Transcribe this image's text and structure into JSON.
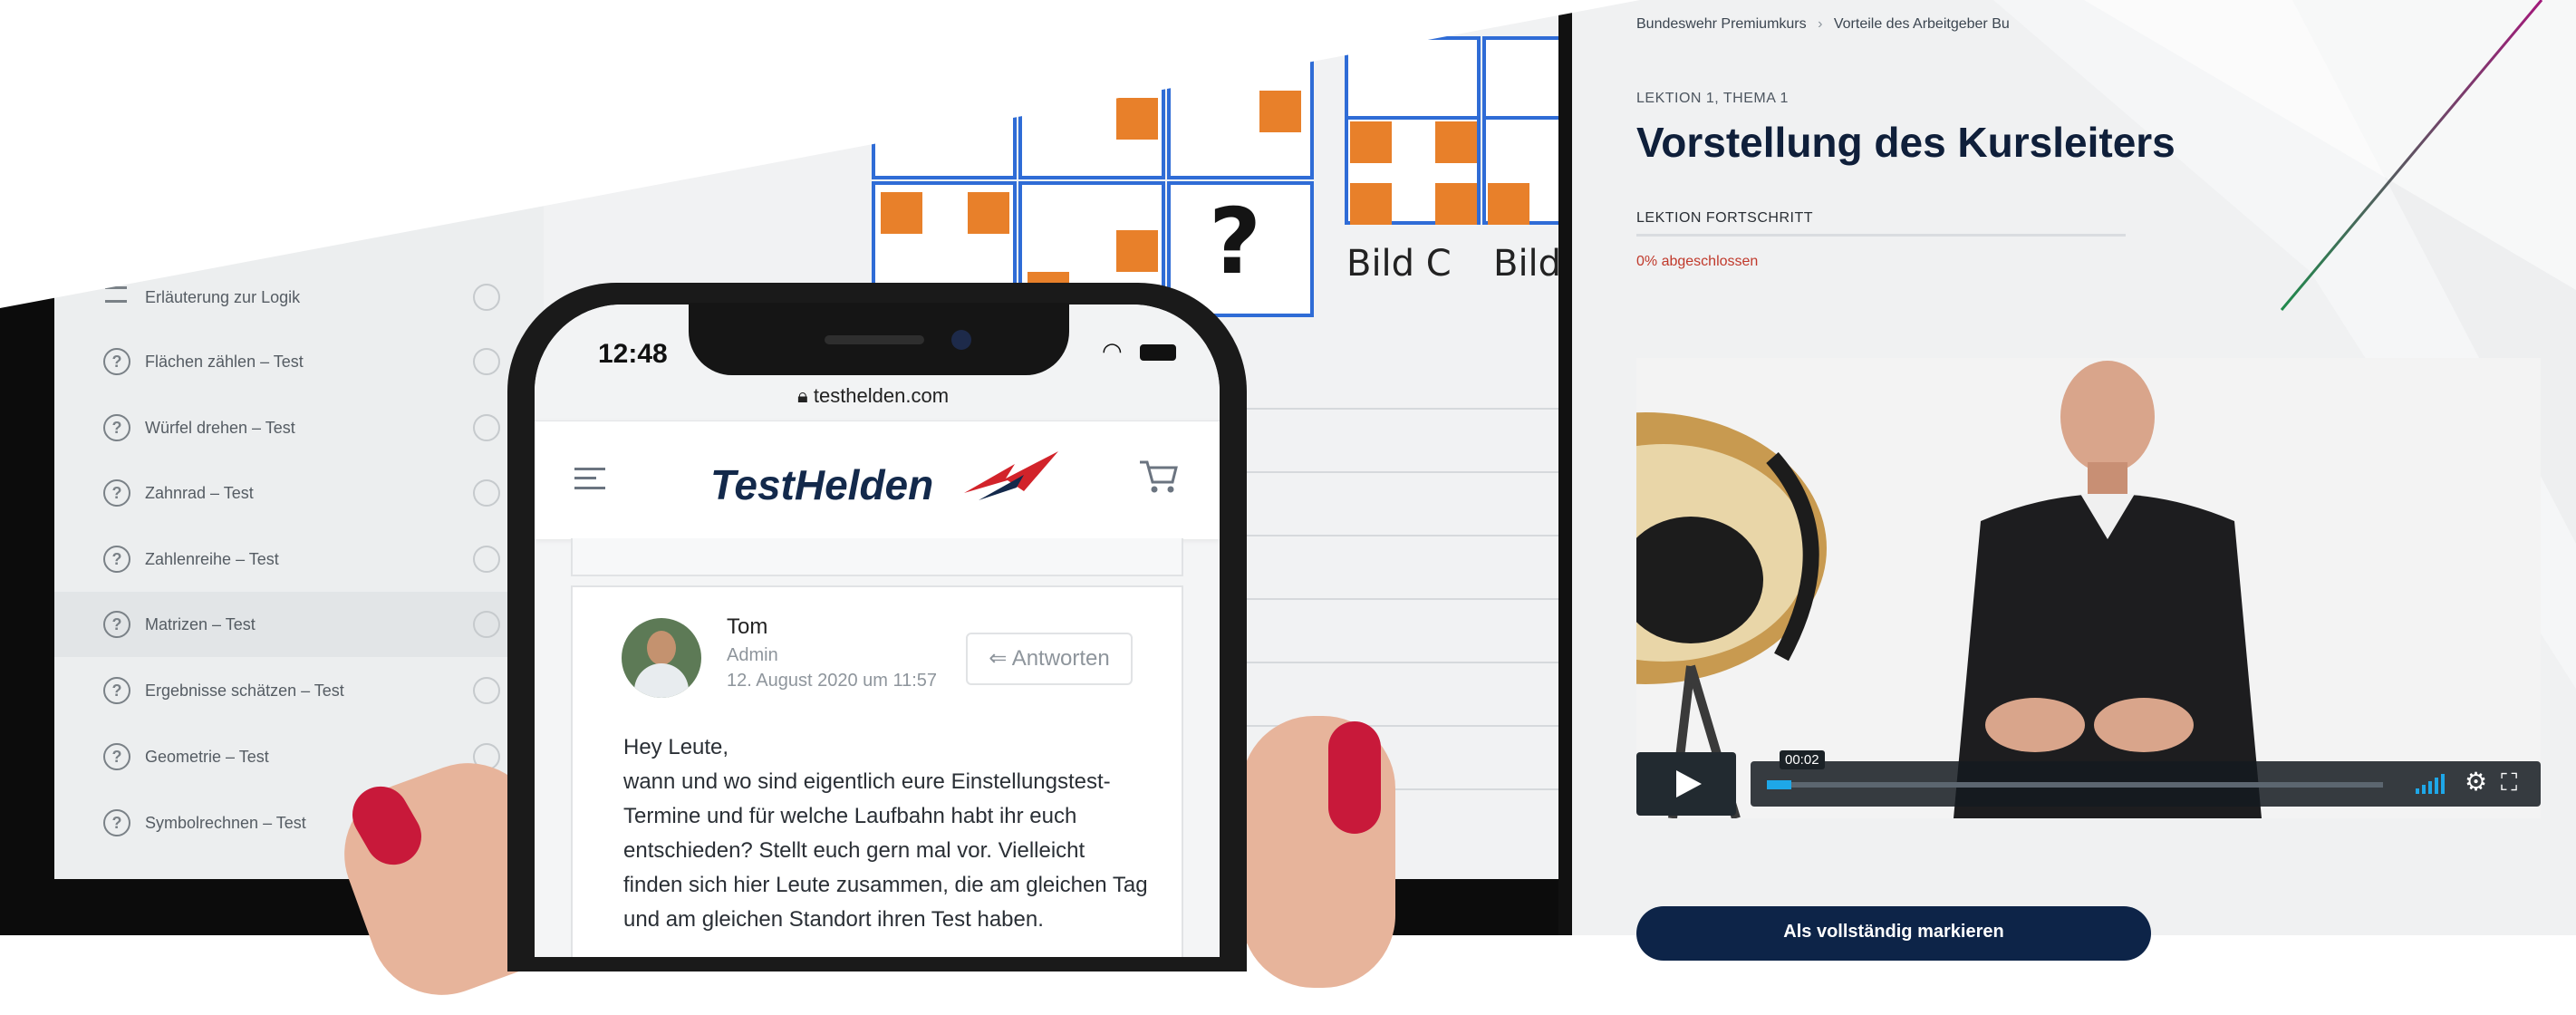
{
  "tablet": {
    "sidebar_items": [
      {
        "label": "Erläuterung zur Logik",
        "icon": "list-icon"
      },
      {
        "label": "Flächen zählen – Test",
        "icon": "question-icon"
      },
      {
        "label": "Würfel drehen – Test",
        "icon": "question-icon"
      },
      {
        "label": "Zahnrad – Test",
        "icon": "question-icon"
      },
      {
        "label": "Zahlenreihe – Test",
        "icon": "question-icon"
      },
      {
        "label": "Matrizen – Test",
        "icon": "question-icon"
      },
      {
        "label": "Ergebnisse schätzen – Test",
        "icon": "question-icon"
      },
      {
        "label": "Geometrie – Test",
        "icon": "question-icon"
      },
      {
        "label": "Symbolrechnen – Test",
        "icon": "question-icon"
      }
    ],
    "puzzle": {
      "question_mark": "?",
      "option_c": "Bild C",
      "option_d": "Bild D",
      "accent_orange": "#e8802a",
      "grid_blue": "#2f6cd6"
    }
  },
  "phone": {
    "time": "12:48",
    "url": "testhelden.com",
    "brand": "TestHelden",
    "comment": {
      "author": "Tom",
      "role": "Admin",
      "date": "12. August 2020 um 11:57",
      "reply_label": "Antworten",
      "body_lines": [
        "Hey Leute,",
        "wann und wo sind eigentlich eure Einstellungstest-",
        "Termine und für welche Laufbahn habt ihr euch",
        "entschieden? Stellt euch gern mal vor. Vielleicht",
        "finden sich hier Leute zusammen, die am gleichen Tag",
        "und am gleichen Standort ihren Test haben."
      ]
    },
    "brand_color": "#13294b",
    "accent_red": "#d2232a"
  },
  "lesson": {
    "breadcrumb_1": "Bundeswehr Premiumkurs",
    "breadcrumb_sep": "›",
    "breadcrumb_2": "Vorteile des Arbeitgeber Bu",
    "kicker": "LEKTION 1, THEMA 1",
    "title": "Vorstellung des Kursleiters",
    "progress_label": "LEKTION FORTSCHRITT",
    "progress_text": "0% abgeschlossen",
    "progress_value": 0,
    "video_time": "00:02",
    "video_progress": 0.04,
    "mark_complete_label": "Als vollständig markieren"
  },
  "decor": {
    "line_gradient": [
      "#1f8a4c",
      "#a21a7a"
    ]
  }
}
